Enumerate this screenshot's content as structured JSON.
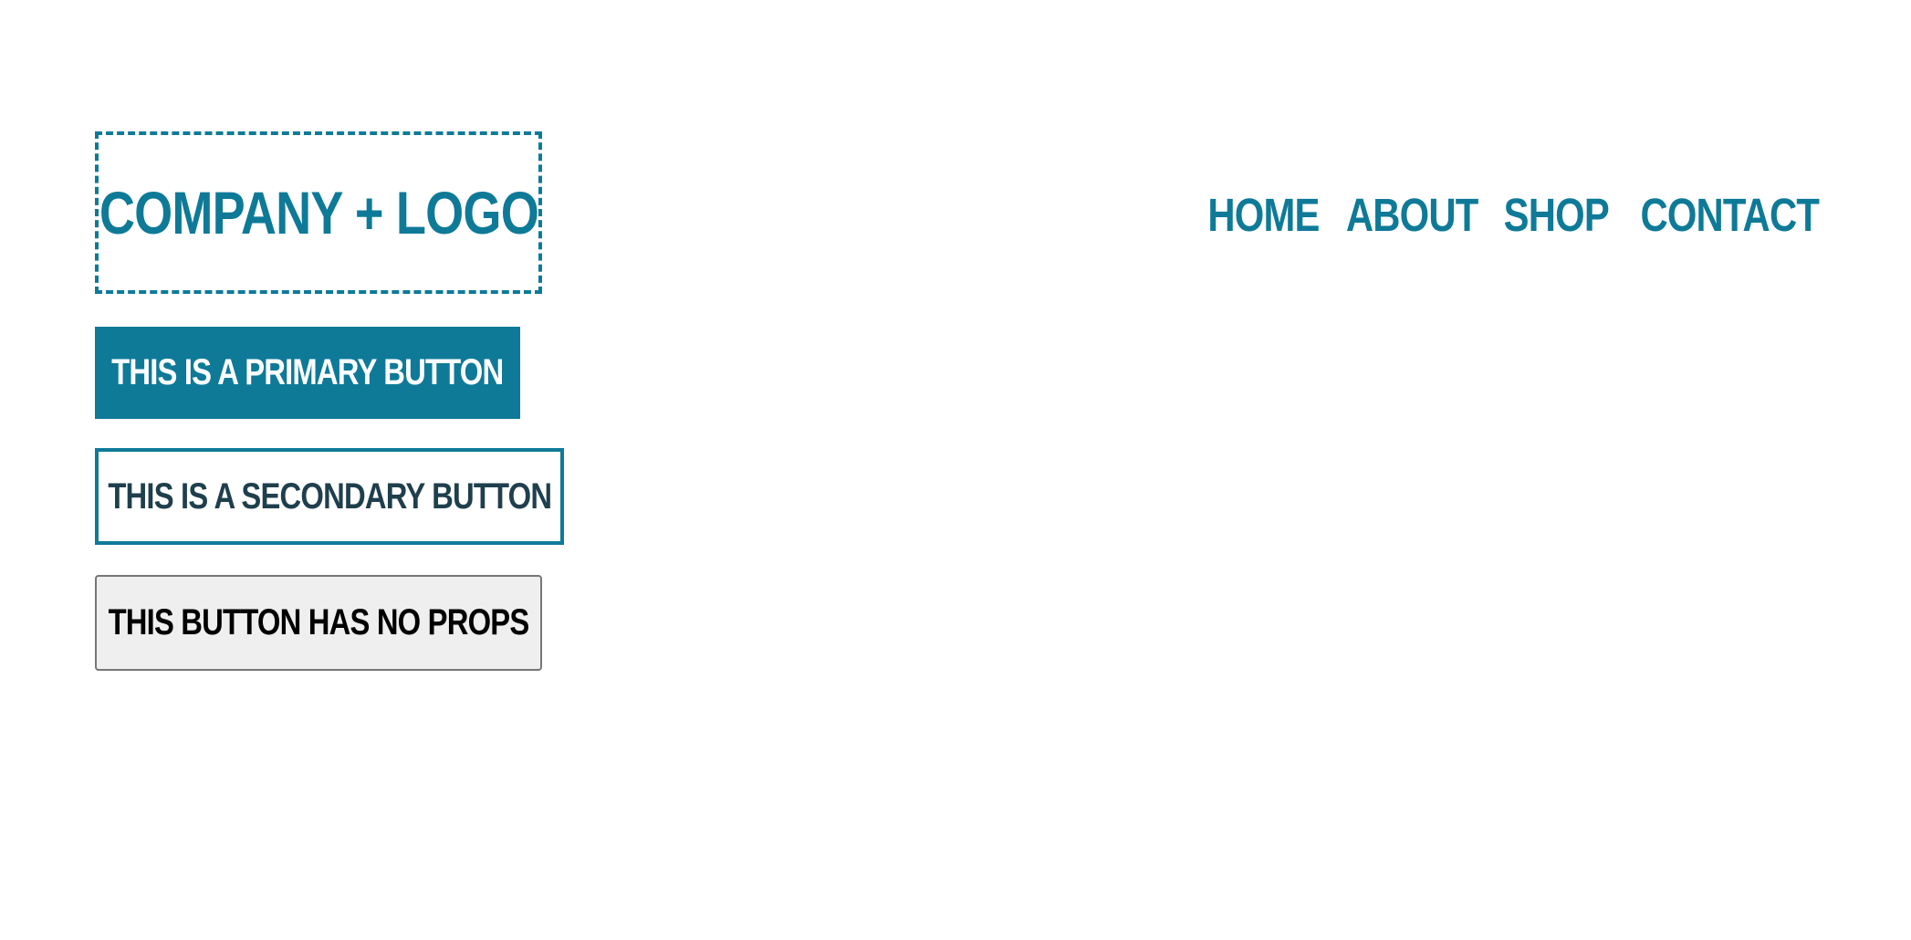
{
  "header": {
    "logo_text": "Company + Logo",
    "nav": {
      "home": "Home",
      "about": "About",
      "shop": "Shop",
      "contact": "Contact"
    }
  },
  "buttons": {
    "primary_label": "This is a primary button",
    "secondary_label": "This is a secondary button",
    "default_label": "This button has no props"
  },
  "colors": {
    "accent": "#0e7a98",
    "secondary_text": "#1f3f4d",
    "default_bg": "#efefef",
    "default_border": "#767676"
  }
}
